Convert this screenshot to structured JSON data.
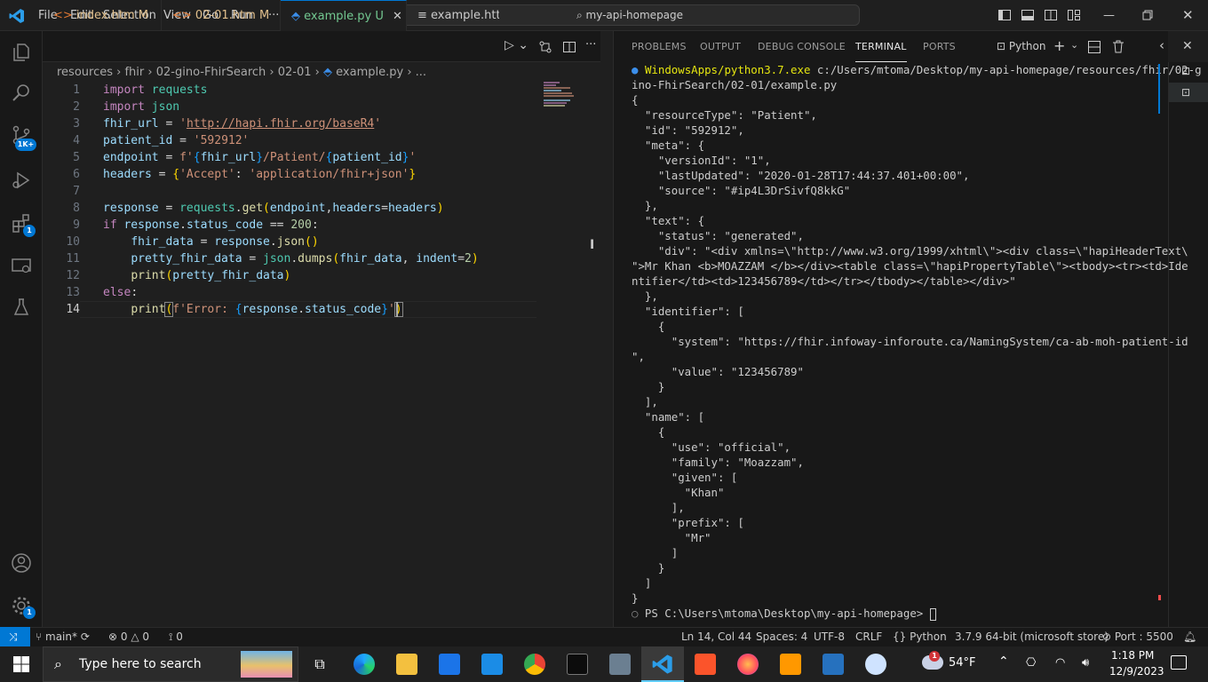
{
  "titlebar": {
    "menus": [
      "File",
      "Edit",
      "Selection",
      "View",
      "Go",
      "Run",
      "···"
    ],
    "search": "my-api-homepage"
  },
  "activitybar": {
    "source_control_badge": "1K+",
    "extensions_badge": "1",
    "settings_badge": "1"
  },
  "editor": {
    "tabs": [
      {
        "label": "index.htm",
        "status": "M"
      },
      {
        "label": "02-01.htm",
        "status": "M"
      },
      {
        "label": "example.py",
        "status": "U"
      },
      {
        "label": "example.http"
      }
    ],
    "breadcrumb": [
      "resources",
      "fhir",
      "02-gino-FhirSearch",
      "02-01",
      "example.py",
      "..."
    ],
    "line_numbers": [
      "1",
      "2",
      "3",
      "4",
      "5",
      "6",
      "7",
      "8",
      "9",
      "10",
      "11",
      "12",
      "13",
      "14"
    ]
  },
  "panel": {
    "tabs": [
      "PROBLEMS",
      "OUTPUT",
      "DEBUG CONSOLE",
      "TERMINAL",
      "PORTS"
    ],
    "shell": "Python",
    "terminal_lines": [
      "WindowsApps/python3.7.exe c:/Users/mtoma/Desktop/my-api-homepage/resources/fhir/02-g",
      "ino-FhirSearch/02-01/example.py",
      "{",
      "  \"resourceType\": \"Patient\",",
      "  \"id\": \"592912\",",
      "  \"meta\": {",
      "    \"versionId\": \"1\",",
      "    \"lastUpdated\": \"2020-01-28T17:44:37.401+00:00\",",
      "    \"source\": \"#ip4L3DrSivfQ8kkG\"",
      "  },",
      "  \"text\": {",
      "    \"status\": \"generated\",",
      "    \"div\": \"<div xmlns=\\\"http://www.w3.org/1999/xhtml\\\"><div class=\\\"hapiHeaderText\\",
      "\">Mr Khan <b>MOAZZAM </b></div><table class=\\\"hapiPropertyTable\\\"><tbody><tr><td>Ide",
      "ntifier</td><td>123456789</td></tr></tbody></table></div>\"",
      "  },",
      "  \"identifier\": [",
      "    {",
      "      \"system\": \"https://fhir.infoway-inforoute.ca/NamingSystem/ca-ab-moh-patient-id",
      "\",",
      "      \"value\": \"123456789\"",
      "    }",
      "  ],",
      "  \"name\": [",
      "    {",
      "      \"use\": \"official\",",
      "      \"family\": \"Moazzam\",",
      "      \"given\": [",
      "        \"Khan\"",
      "      ],",
      "      \"prefix\": [",
      "        \"Mr\"",
      "      ]",
      "    }",
      "  ]",
      "}"
    ],
    "prompt": "PS C:\\Users\\mtoma\\Desktop\\my-api-homepage> "
  },
  "statusbar": {
    "branch": "main*",
    "errors": "0",
    "warnings": "0",
    "ports_fwd": "0",
    "cursor": "Ln 14, Col 44",
    "spaces": "Spaces: 4",
    "encoding": "UTF-8",
    "eol": "CRLF",
    "language": "Python",
    "interpreter": "3.7.9 64-bit (microsoft store)",
    "port": "Port : 5500"
  },
  "taskbar": {
    "search_placeholder": "Type here to search",
    "weather": "54°F",
    "weather_badge": "1",
    "time": "1:18 PM",
    "date": "12/9/2023"
  },
  "colors": {
    "accent": "#0078d4",
    "modified": "#e2c08d",
    "untracked": "#73c991"
  }
}
